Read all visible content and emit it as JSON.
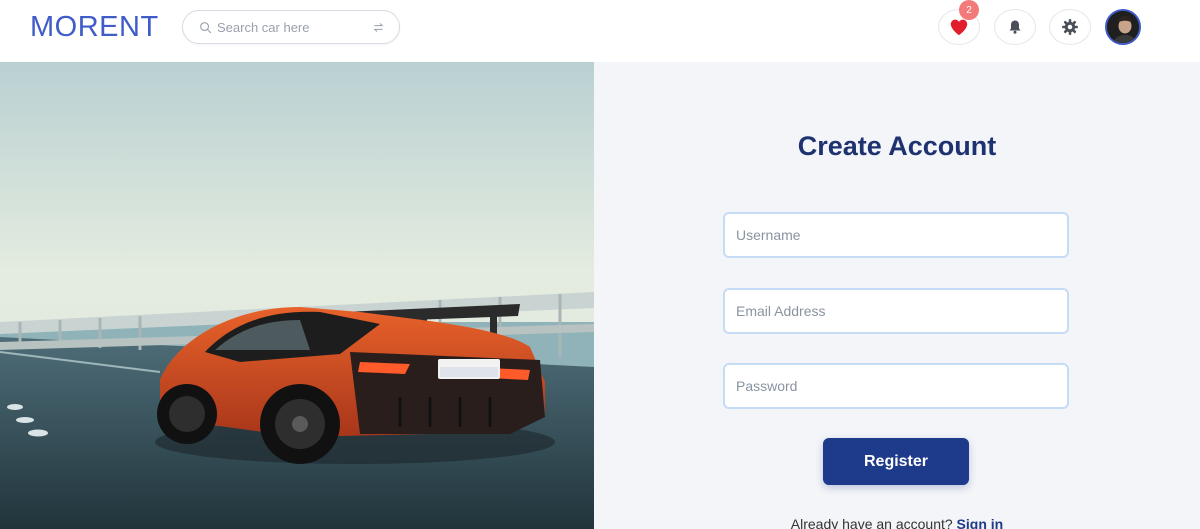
{
  "header": {
    "logo": "MORENT",
    "search_placeholder": "Search car here",
    "favorites_badge": "2",
    "icons": {
      "search": "search-icon",
      "filter": "swap-icon",
      "favorites": "heart-icon",
      "notifications": "bell-icon",
      "settings": "gear-icon"
    }
  },
  "form": {
    "title": "Create Account",
    "username_placeholder": "Username",
    "email_placeholder": "Email Address",
    "password_placeholder": "Password",
    "register_label": "Register",
    "signin_prompt": "Already have an account?",
    "signin_link": "Sign in"
  },
  "colors": {
    "brand": "#3f5cc8",
    "title": "#1e3270",
    "button": "#1e3a8a",
    "badge": "#f47a7a",
    "heart": "#e11d2e"
  }
}
